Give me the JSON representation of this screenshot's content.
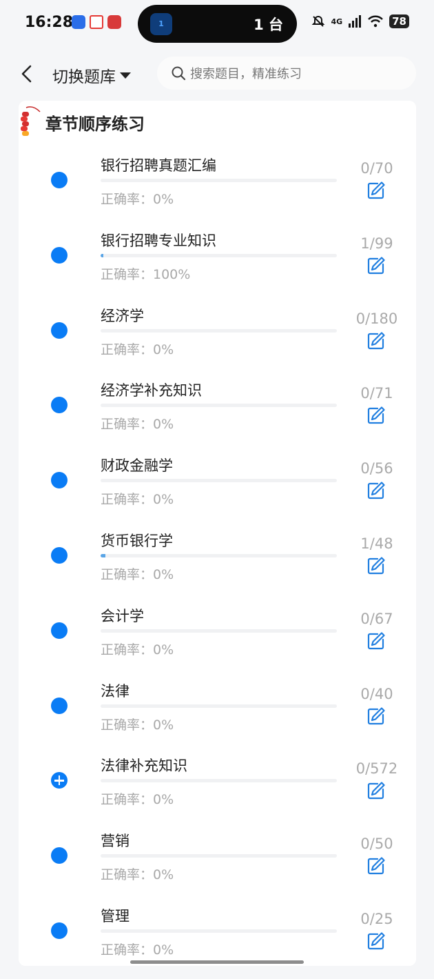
{
  "status_bar": {
    "time": "16:28",
    "island_text": "1 台",
    "island_badge": "1",
    "network": "4G",
    "battery": "78"
  },
  "header": {
    "bank_switch": "切换题库",
    "search_placeholder": "搜索题目，精准练习"
  },
  "section_title": "章节顺序练习",
  "accent_color": "#0a7cf5",
  "chapters": [
    {
      "name": "银行招聘真题汇编",
      "accuracy": "正确率：0%",
      "count": "0/70",
      "done": 0,
      "total": 70,
      "icon": "dot"
    },
    {
      "name": "银行招聘专业知识",
      "accuracy": "正确率：100%",
      "count": "1/99",
      "done": 1,
      "total": 99,
      "icon": "dot"
    },
    {
      "name": "经济学",
      "accuracy": "正确率：0%",
      "count": "0/180",
      "done": 0,
      "total": 180,
      "icon": "dot"
    },
    {
      "name": "经济学补充知识",
      "accuracy": "正确率：0%",
      "count": "0/71",
      "done": 0,
      "total": 71,
      "icon": "dot"
    },
    {
      "name": "财政金融学",
      "accuracy": "正确率：0%",
      "count": "0/56",
      "done": 0,
      "total": 56,
      "icon": "dot"
    },
    {
      "name": "货币银行学",
      "accuracy": "正确率：0%",
      "count": "1/48",
      "done": 1,
      "total": 48,
      "icon": "dot"
    },
    {
      "name": "会计学",
      "accuracy": "正确率：0%",
      "count": "0/67",
      "done": 0,
      "total": 67,
      "icon": "dot"
    },
    {
      "name": "法律",
      "accuracy": "正确率：0%",
      "count": "0/40",
      "done": 0,
      "total": 40,
      "icon": "dot"
    },
    {
      "name": "法律补充知识",
      "accuracy": "正确率：0%",
      "count": "0/572",
      "done": 0,
      "total": 572,
      "icon": "plus"
    },
    {
      "name": "营销",
      "accuracy": "正确率：0%",
      "count": "0/50",
      "done": 0,
      "total": 50,
      "icon": "dot"
    },
    {
      "name": "管理",
      "accuracy": "正确率：0%",
      "count": "0/25",
      "done": 0,
      "total": 25,
      "icon": "dot"
    }
  ]
}
